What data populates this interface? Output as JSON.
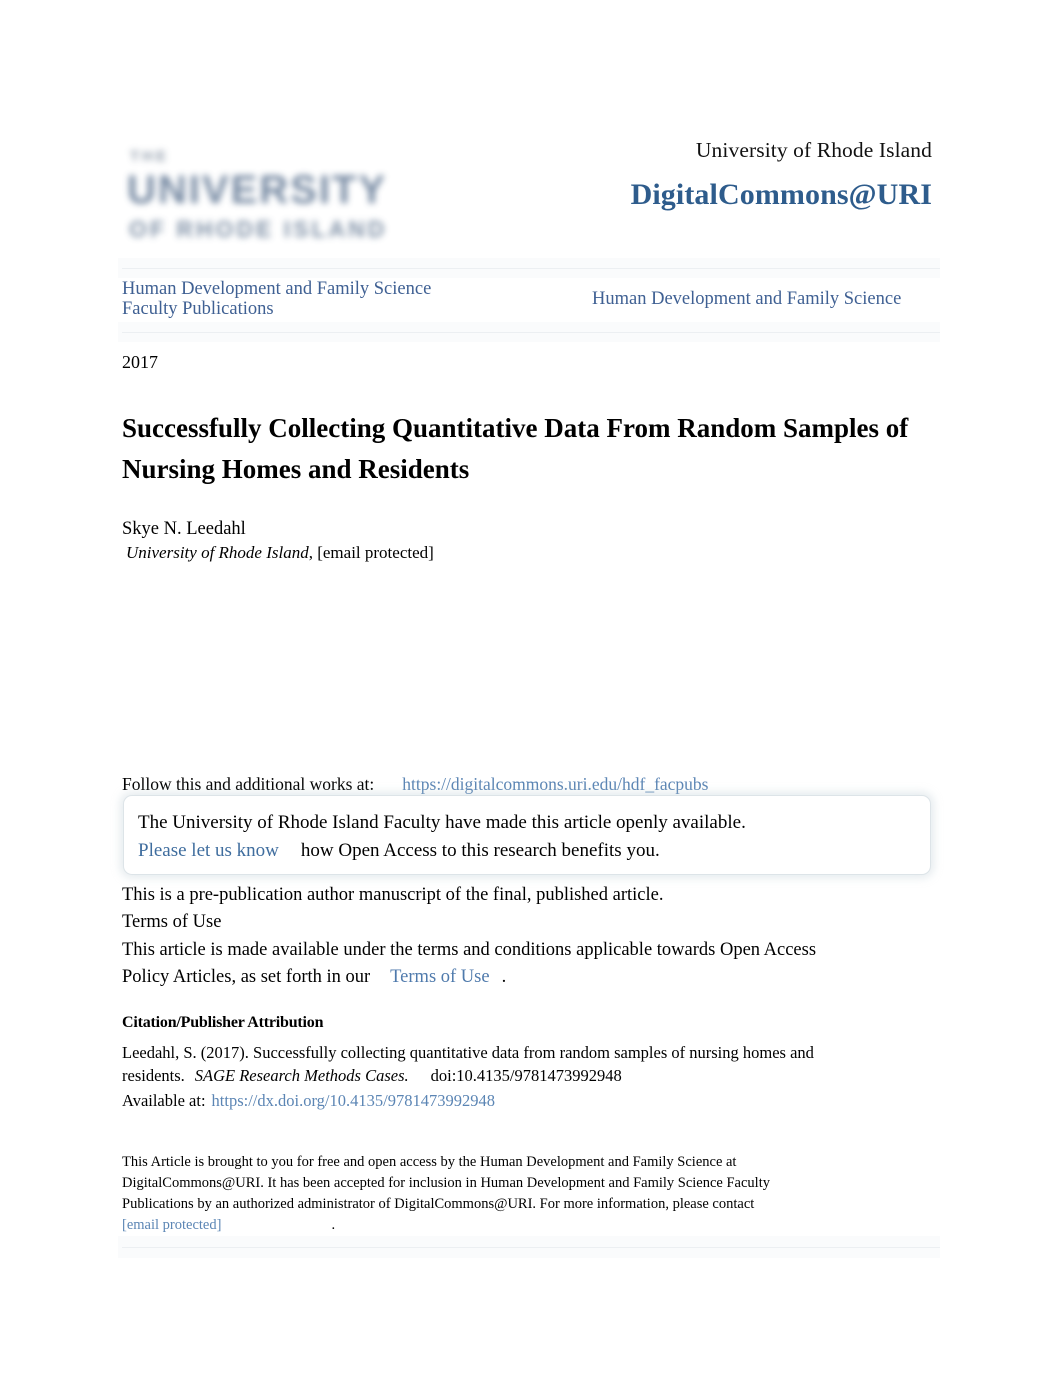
{
  "header": {
    "logo": {
      "line1": "THE",
      "line2": "UNIVERSITY",
      "line3": "OF RHODE ISLAND",
      "alt": "University of Rhode Island logo"
    },
    "institution": "University of Rhode Island",
    "repository": "DigitalCommons@URI"
  },
  "series": {
    "left": "Human Development and Family Science\nFaculty Publications",
    "left_line1": "Human Development and Family Science",
    "left_line2": "Faculty Publications",
    "right": "Human Development and Family Science"
  },
  "article": {
    "year": "2017",
    "title": "Successfully Collecting Quantitative Data From Random Samples of Nursing Homes and Residents",
    "author": "Skye N. Leedahl",
    "affiliation": "University of Rhode Island",
    "affiliation_separator": ", ",
    "author_email": "[email protected]"
  },
  "follow": {
    "label": "Follow this and additional works at:",
    "url": "https://digitalcommons.uri.edu/hdf_facpubs"
  },
  "callout": {
    "line1": "The University of Rhode Island Faculty have made this article openly available.",
    "link": "Please let us know",
    "line2_rest": "how Open Access to this research benefits you."
  },
  "terms": {
    "prepub_note": "This is a pre-publication author manuscript of the final, published article.",
    "heading": "Terms of Use",
    "body_line1": "This article is made available under the terms and conditions applicable towards Open Access",
    "body_line2_prefix": "Policy Articles, as set forth in our",
    "body_link": "Terms of Use",
    "body_period": "."
  },
  "citation": {
    "heading": "Citation/Publisher Attribution",
    "text_line1": "Leedahl, S. (2017). Successfully collecting quantitative data from random samples of nursing homes and",
    "text_line2_prefix": "residents.",
    "journal": "SAGE Research Methods Cases.",
    "doi": "doi:10.4135/9781473992948",
    "available_label": "Available at:",
    "available_url": "https://dx.doi.org/10.4135/9781473992948"
  },
  "footer": {
    "line1": "This Article is brought to you for free and open access by the Human Development and Family Science at",
    "line2": "DigitalCommons@URI. It has been accepted for inclusion in Human Development and Family Science Faculty",
    "line3": "Publications by an authorized administrator of DigitalCommons@URI. For more information, please contact",
    "email": "[email protected]",
    "period": "."
  },
  "colors": {
    "repository_blue": "#2e5c8c",
    "series_blue": "#3f6093",
    "link_blue": "#5b85b4",
    "callout_link_blue": "#3f6d9e",
    "band_gray": "#fafbfc",
    "rule_gray": "#eceff2",
    "text_black": "#000000"
  }
}
